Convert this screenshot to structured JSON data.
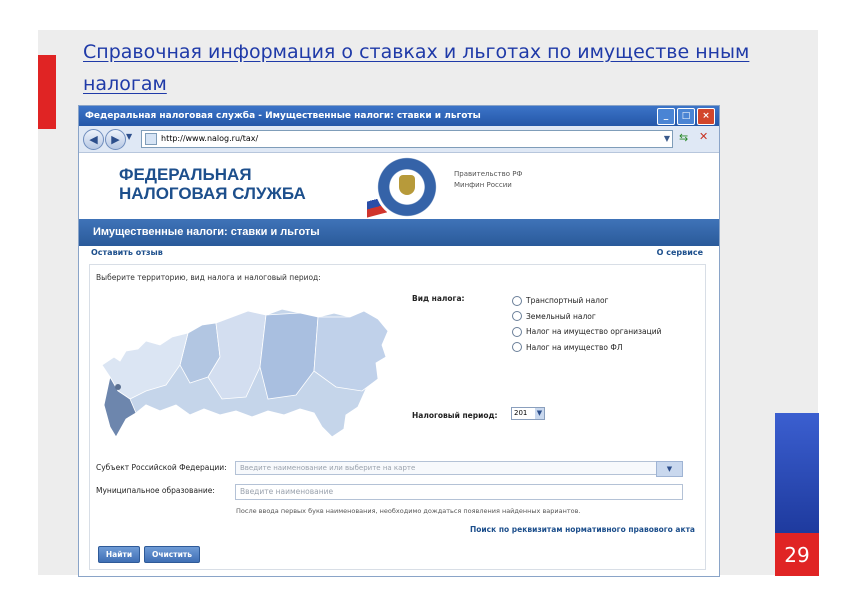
{
  "slide": {
    "title": "Справочная информация о ставках и льготах по имуществе нным налогам",
    "page_number": "29",
    "colors": {
      "accent_red": "#e02424",
      "accent_blue": "#2b4ea8",
      "title_blue": "#1f3aa8"
    }
  },
  "browser": {
    "window_title": "Федеральная налоговая служба - Имущественные налоги: ставки и льготы",
    "url": "http://www.nalog.ru/tax/",
    "buttons": {
      "minimize": "_",
      "maximize": "□",
      "close": "×"
    }
  },
  "site": {
    "logo_line1": "ФЕДЕРАЛЬНАЯ",
    "logo_line2": "НАЛОГОВАЯ СЛУЖБА",
    "gov_line1": "Правительство РФ",
    "gov_line2": "Минфин России",
    "section_title": "Имущественные налоги: ставки и льготы",
    "feedback_link": "Оставить отзыв",
    "about_link": "О сервисе"
  },
  "form": {
    "prompt": "Выберите территорию, вид налога и налоговый период:",
    "tax_type_label": "Вид налога:",
    "tax_types": [
      "Транспортный налог",
      "Земельный налог",
      "Налог на имущество организаций",
      "Налог на имущество ФЛ"
    ],
    "period_label": "Налоговый период:",
    "period_value": "201",
    "subject_label": "Субъект Российской Федерации:",
    "subject_placeholder": "Введите наименование или выберите на карте",
    "municipal_label": "Муниципальное образование:",
    "municipal_placeholder": "Введите наименование",
    "hint": "После ввода первых букв наименования, необходимо дождаться появления найденных вариантов.",
    "requisites_link": "Поиск по реквизитам нормативного правового акта",
    "find_button": "Найти",
    "clear_button": "Очистить"
  }
}
